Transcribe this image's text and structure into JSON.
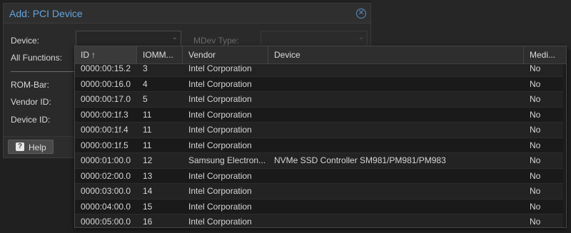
{
  "dialog": {
    "title": "Add: PCI Device",
    "close_icon": "close-circle-icon",
    "labels": {
      "device": "Device:",
      "all_functions": "All Functions:",
      "rom_bar": "ROM-Bar:",
      "vendor_id": "Vendor ID:",
      "device_id": "Device ID:"
    },
    "device_combo": {
      "value": "",
      "arrow": "chevron-down-icon"
    },
    "mdev": {
      "label": "MDev Type:",
      "value": ""
    },
    "help_button": {
      "label": "Help",
      "icon": "question-icon"
    }
  },
  "grid": {
    "columns": [
      {
        "label": "ID",
        "sorted": "ascending"
      },
      {
        "label": "IOMM..."
      },
      {
        "label": "Vendor"
      },
      {
        "label": "Device"
      },
      {
        "label": "Medi..."
      }
    ],
    "rows": [
      {
        "id": "0000:00:15.2",
        "iommu": "3",
        "vendor": "Intel Corporation",
        "device": "",
        "medi": "No"
      },
      {
        "id": "0000:00:16.0",
        "iommu": "4",
        "vendor": "Intel Corporation",
        "device": "",
        "medi": "No"
      },
      {
        "id": "0000:00:17.0",
        "iommu": "5",
        "vendor": "Intel Corporation",
        "device": "",
        "medi": "No"
      },
      {
        "id": "0000:00:1f.3",
        "iommu": "11",
        "vendor": "Intel Corporation",
        "device": "",
        "medi": "No"
      },
      {
        "id": "0000:00:1f.4",
        "iommu": "11",
        "vendor": "Intel Corporation",
        "device": "",
        "medi": "No"
      },
      {
        "id": "0000:00:1f.5",
        "iommu": "11",
        "vendor": "Intel Corporation",
        "device": "",
        "medi": "No"
      },
      {
        "id": "0000:01:00.0",
        "iommu": "12",
        "vendor": "Samsung Electron...",
        "device": "NVMe SSD Controller SM981/PM981/PM983",
        "medi": "No"
      },
      {
        "id": "0000:02:00.0",
        "iommu": "13",
        "vendor": "Intel Corporation",
        "device": "",
        "medi": "No"
      },
      {
        "id": "0000:03:00.0",
        "iommu": "14",
        "vendor": "Intel Corporation",
        "device": "",
        "medi": "No"
      },
      {
        "id": "0000:04:00.0",
        "iommu": "15",
        "vendor": "Intel Corporation",
        "device": "",
        "medi": "No"
      },
      {
        "id": "0000:05:00.0",
        "iommu": "16",
        "vendor": "Intel Corporation",
        "device": "",
        "medi": "No"
      }
    ]
  }
}
